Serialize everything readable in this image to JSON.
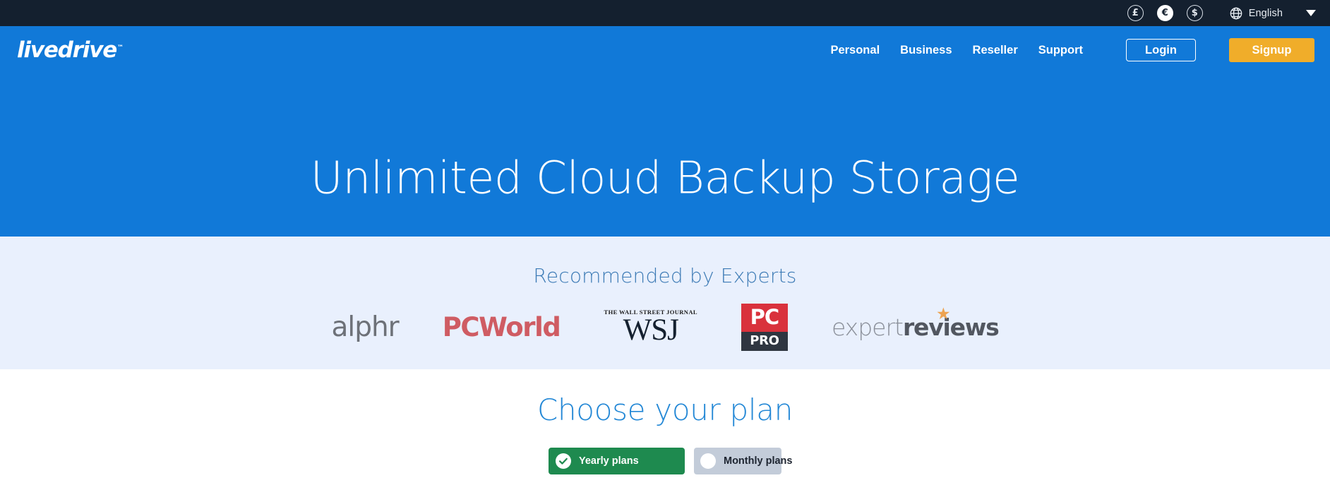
{
  "topbar": {
    "currencies": [
      {
        "symbol": "£",
        "name": "pound",
        "active": false
      },
      {
        "symbol": "€",
        "name": "euro",
        "active": true
      },
      {
        "symbol": "$",
        "name": "dollar",
        "active": false
      }
    ],
    "globe_icon": "globe-icon",
    "language": "English",
    "dropdown_icon": "chevron-down-icon",
    "background_color": "#14202f"
  },
  "header": {
    "logo_text": "livedrive",
    "logo_tm": "™",
    "nav": [
      {
        "label": "Personal"
      },
      {
        "label": "Business"
      },
      {
        "label": "Reseller"
      },
      {
        "label": "Support"
      }
    ],
    "login_label": "Login",
    "signup_label": "Signup",
    "signup_color": "#f0ad2a",
    "background_color": "#1179d8"
  },
  "hero": {
    "title": "Unlimited Cloud Backup Storage"
  },
  "experts": {
    "title": "Recommended by Experts",
    "band_color": "#e9f0fd",
    "title_color": "#3c7ab5",
    "logos": [
      {
        "name": "alphr-logo",
        "text": "alphr",
        "color": "#6d7178"
      },
      {
        "name": "pcworld-logo",
        "text": "PCWorld",
        "color": "#cf5c63"
      },
      {
        "name": "wsj-logo",
        "top_text": "THE WALL STREET JOURNAL",
        "text": "WSJ",
        "color": "#14202f"
      },
      {
        "name": "pcpro-logo",
        "text_top": "PC",
        "text_bottom": "PRO",
        "color": "#d9323c"
      },
      {
        "name": "expert-reviews-logo",
        "text_light": "expert",
        "text_bold": "reviews",
        "star": "★",
        "star_color": "#eda351"
      }
    ]
  },
  "plans": {
    "title": "Choose your plan",
    "title_color": "#2488d6",
    "toggles": [
      {
        "label": "Yearly plans",
        "selected": true,
        "color": "#1e8a4f"
      },
      {
        "label": "Monthly plans",
        "selected": false,
        "color": "#c3ccd9"
      }
    ]
  }
}
